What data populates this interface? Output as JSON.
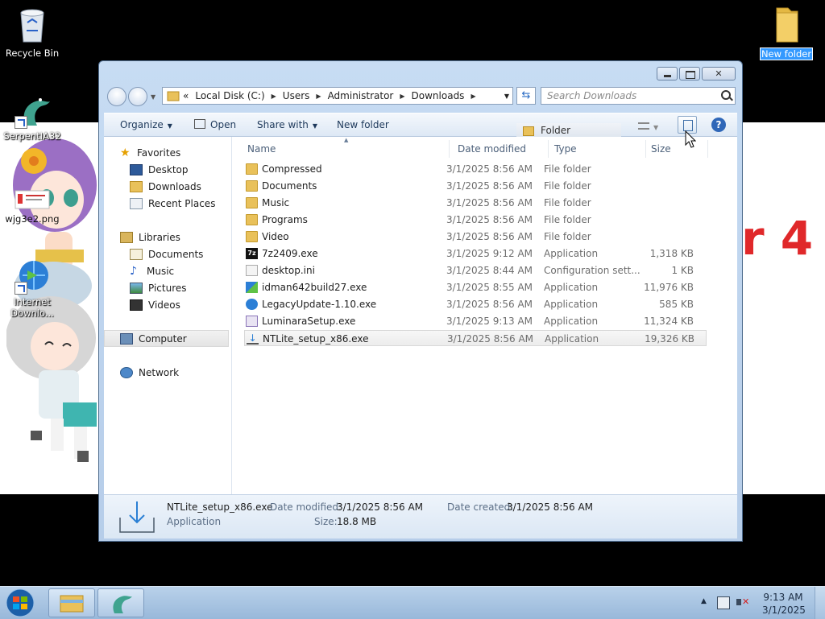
{
  "desktop": {
    "icons": [
      {
        "label": "Recycle Bin"
      },
      {
        "label": "SerpentIA32"
      },
      {
        "label": "wjg3e2.png"
      },
      {
        "label": "Internet Downlo..."
      },
      {
        "label": "New folder"
      }
    ],
    "wallpaper_text": "r 4"
  },
  "window": {
    "address": {
      "prefix": "«",
      "crumbs": [
        "Local Disk (C:)",
        "Users",
        "Administrator",
        "Downloads"
      ]
    },
    "search_placeholder": "Search Downloads",
    "toolbar": {
      "organize": "Organize",
      "open": "Open",
      "share_with": "Share with",
      "new_folder": "New folder",
      "tooltip": "Folder"
    },
    "nav": {
      "favorites": "Favorites",
      "desktop": "Desktop",
      "downloads": "Downloads",
      "recent": "Recent Places",
      "libraries": "Libraries",
      "documents": "Documents",
      "music": "Music",
      "pictures": "Pictures",
      "videos": "Videos",
      "computer": "Computer",
      "network": "Network"
    },
    "columns": {
      "name": "Name",
      "date": "Date modified",
      "type": "Type",
      "size": "Size"
    },
    "files": [
      {
        "name": "Compressed",
        "date": "3/1/2025 8:56 AM",
        "type": "File folder",
        "size": "",
        "icon": "folder"
      },
      {
        "name": "Documents",
        "date": "3/1/2025 8:56 AM",
        "type": "File folder",
        "size": "",
        "icon": "folder"
      },
      {
        "name": "Music",
        "date": "3/1/2025 8:56 AM",
        "type": "File folder",
        "size": "",
        "icon": "folder"
      },
      {
        "name": "Programs",
        "date": "3/1/2025 8:56 AM",
        "type": "File folder",
        "size": "",
        "icon": "folder"
      },
      {
        "name": "Video",
        "date": "3/1/2025 8:56 AM",
        "type": "File folder",
        "size": "",
        "icon": "folder"
      },
      {
        "name": "7z2409.exe",
        "date": "3/1/2025 9:12 AM",
        "type": "Application",
        "size": "1,318 KB",
        "icon": "7z"
      },
      {
        "name": "desktop.ini",
        "date": "3/1/2025 8:44 AM",
        "type": "Configuration sett...",
        "size": "1 KB",
        "icon": "ini"
      },
      {
        "name": "idman642build27.exe",
        "date": "3/1/2025 8:55 AM",
        "type": "Application",
        "size": "11,976 KB",
        "icon": "idm"
      },
      {
        "name": "LegacyUpdate-1.10.exe",
        "date": "3/1/2025 8:56 AM",
        "type": "Application",
        "size": "585 KB",
        "icon": "globe"
      },
      {
        "name": "LuminaraSetup.exe",
        "date": "3/1/2025 9:13 AM",
        "type": "Application",
        "size": "11,324 KB",
        "icon": "setup"
      },
      {
        "name": "NTLite_setup_x86.exe",
        "date": "3/1/2025 8:56 AM",
        "type": "Application",
        "size": "19,326 KB",
        "icon": "download"
      }
    ],
    "details": {
      "name": "NTLite_setup_x86.exe",
      "type": "Application",
      "modified_label": "Date modified:",
      "modified_value": "3/1/2025 8:56 AM",
      "created_label": "Date created:",
      "created_value": "3/1/2025 8:56 AM",
      "size_label": "Size:",
      "size_value": "18.8 MB"
    }
  },
  "taskbar": {
    "time": "9:13 AM",
    "date": "3/1/2025"
  },
  "colors": {
    "wallpaper_red": "#e0282a",
    "folder_yellow": "#e9c15a",
    "window_frame": "#c7dcf3"
  }
}
